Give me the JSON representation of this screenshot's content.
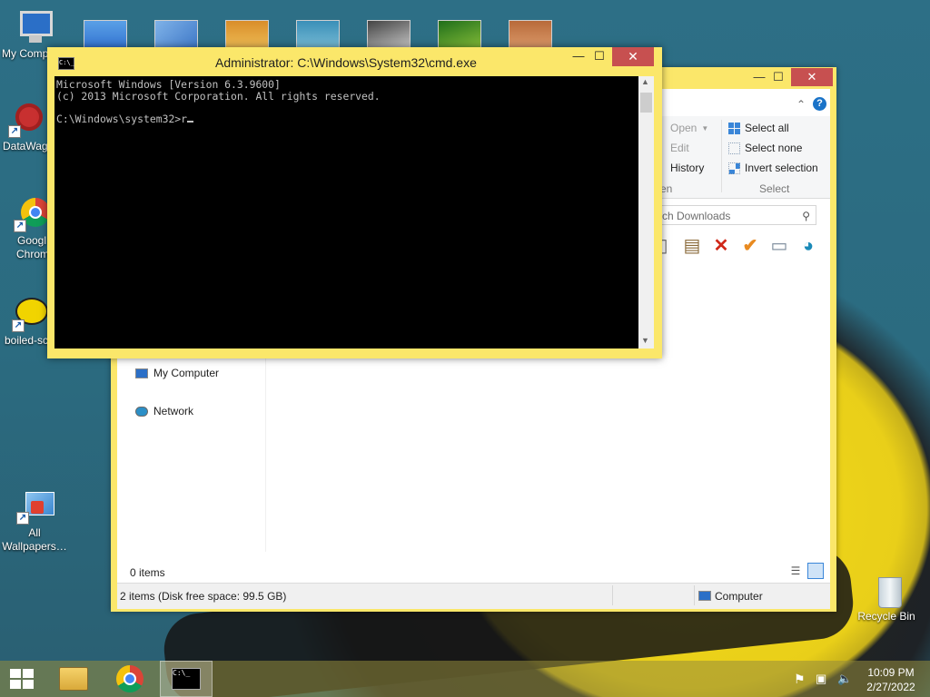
{
  "desktop": {
    "icons": [
      {
        "label": "My Comp…",
        "icon": "computer-icon"
      },
      {
        "label": "DataWag",
        "icon": "gear-icon"
      },
      {
        "label": "Googl Chrom",
        "icon": "chrome-icon"
      },
      {
        "label": "boiled-sc",
        "icon": "boiled-egg-icon"
      },
      {
        "label": "All Wallpapers…",
        "icon": "wallpapers-icon"
      },
      {
        "label": "Recycle Bin",
        "icon": "recycle-bin-icon"
      }
    ]
  },
  "cmd": {
    "title": "Administrator: C:\\Windows\\System32\\cmd.exe",
    "icon_text": "C:\\_",
    "lines": [
      "Microsoft Windows [Version 6.3.9600]",
      "(c) 2013 Microsoft Corporation. All rights reserved.",
      "",
      "C:\\Windows\\system32>r"
    ],
    "minimize": "—",
    "maximize": "☐",
    "close": "✕"
  },
  "explorer": {
    "minimize": "—",
    "maximize": "☐",
    "close": "✕",
    "ribbon": {
      "open_group": {
        "open": "Open",
        "edit": "Edit",
        "history": "History",
        "label_partial": "en"
      },
      "select_group": {
        "select_all": "Select all",
        "select_none": "Select none",
        "invert_selection": "Invert selection",
        "label": "Select"
      }
    },
    "search_placeholder": "rch Downloads",
    "nav": {
      "my_computer": "My Computer",
      "network": "Network"
    },
    "items_count": "0 items",
    "status": {
      "left": "2 items (Disk free space: 99.5 GB)",
      "right": "Computer"
    }
  },
  "taskbar": {
    "start_icon": "windows-logo-icon",
    "buttons": [
      "file-explorer-icon",
      "chrome-icon",
      "cmd-icon"
    ],
    "time": "10:09 PM",
    "date": "2/27/2022"
  },
  "colors": {
    "window_frame": "#fbe76a",
    "close_red": "#c75050",
    "console_bg": "#000000",
    "console_text": "#c0c0c0",
    "desktop_teal": "#2d6f86"
  }
}
